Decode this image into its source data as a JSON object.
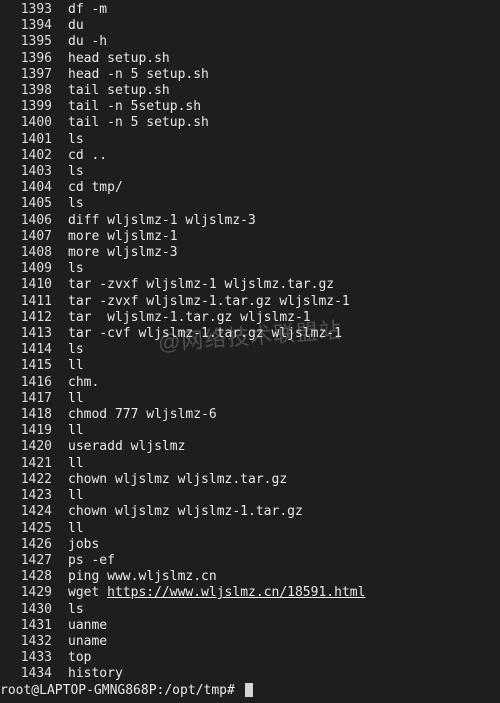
{
  "history": [
    {
      "n": "1393",
      "c": "df -m"
    },
    {
      "n": "1394",
      "c": "du"
    },
    {
      "n": "1395",
      "c": "du -h"
    },
    {
      "n": "1396",
      "c": "head setup.sh"
    },
    {
      "n": "1397",
      "c": "head -n 5 setup.sh"
    },
    {
      "n": "1398",
      "c": "tail setup.sh"
    },
    {
      "n": "1399",
      "c": "tail -n 5setup.sh"
    },
    {
      "n": "1400",
      "c": "tail -n 5 setup.sh"
    },
    {
      "n": "1401",
      "c": "ls"
    },
    {
      "n": "1402",
      "c": "cd .."
    },
    {
      "n": "1403",
      "c": "ls"
    },
    {
      "n": "1404",
      "c": "cd tmp/"
    },
    {
      "n": "1405",
      "c": "ls"
    },
    {
      "n": "1406",
      "c": "diff wljslmz-1 wljslmz-3"
    },
    {
      "n": "1407",
      "c": "more wljslmz-1"
    },
    {
      "n": "1408",
      "c": "more wljslmz-3"
    },
    {
      "n": "1409",
      "c": "ls"
    },
    {
      "n": "1410",
      "c": "tar -zvxf wljslmz-1 wljslmz.tar.gz"
    },
    {
      "n": "1411",
      "c": "tar -zvxf wljslmz-1.tar.gz wljslmz-1"
    },
    {
      "n": "1412",
      "c": "tar  wljslmz-1.tar.gz wljslmz-1"
    },
    {
      "n": "1413",
      "c": "tar -cvf wljslmz-1.tar.gz wljslmz-1"
    },
    {
      "n": "1414",
      "c": "ls"
    },
    {
      "n": "1415",
      "c": "ll"
    },
    {
      "n": "1416",
      "c": "chm."
    },
    {
      "n": "1417",
      "c": "ll"
    },
    {
      "n": "1418",
      "c": "chmod 777 wljslmz-6"
    },
    {
      "n": "1419",
      "c": "ll"
    },
    {
      "n": "1420",
      "c": "useradd wljslmz"
    },
    {
      "n": "1421",
      "c": "ll"
    },
    {
      "n": "1422",
      "c": "chown wljslmz wljslmz.tar.gz"
    },
    {
      "n": "1423",
      "c": "ll"
    },
    {
      "n": "1424",
      "c": "chown wljslmz wljslmz-1.tar.gz"
    },
    {
      "n": "1425",
      "c": "ll"
    },
    {
      "n": "1426",
      "c": "jobs"
    },
    {
      "n": "1427",
      "c": "ps -ef"
    },
    {
      "n": "1428",
      "c": "ping www.wljslmz.cn"
    },
    {
      "n": "1429",
      "c_pre": "wget ",
      "c_url": "https://www.wljslmz.cn/18591.html"
    },
    {
      "n": "1430",
      "c": "ls"
    },
    {
      "n": "1431",
      "c": "uanme"
    },
    {
      "n": "1432",
      "c": "uname"
    },
    {
      "n": "1433",
      "c": "top"
    },
    {
      "n": "1434",
      "c": "history"
    }
  ],
  "prompt": "root@LAPTOP-GMNG868P:/opt/tmp# ",
  "watermark": "@网络技术联盟站"
}
